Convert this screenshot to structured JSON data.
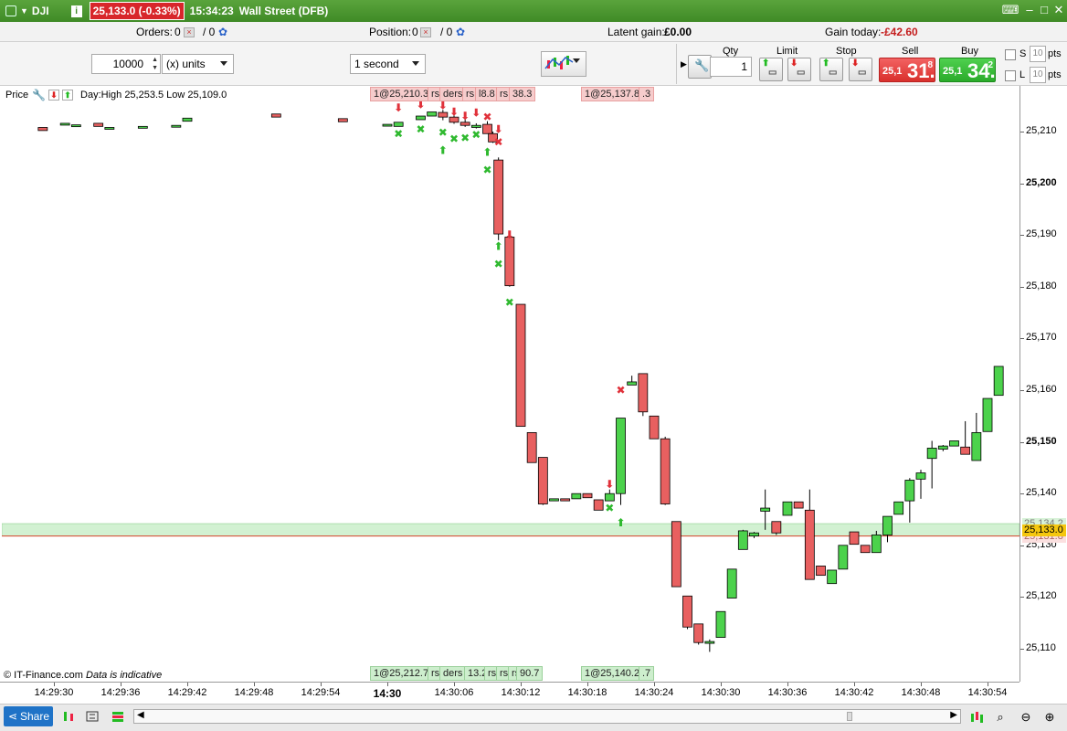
{
  "title_bar": {
    "symbol": "DJI",
    "price_badge": "25,133.0 (-0.33%)",
    "time": "15:34:23",
    "market": "Wall Street (DFB)"
  },
  "orders_row": {
    "orders_label": "Orders:",
    "orders_value": "0",
    "orders_slash": "/ 0",
    "position_label": "Position:",
    "position_value": "0",
    "position_slash": "/ 0",
    "latent_label": "Latent gain:",
    "latent_value": "£0.00",
    "gain_label": "Gain today:",
    "gain_value": "-£42.60"
  },
  "toolbar": {
    "quantity_value": "10000",
    "units_select": "(x) units",
    "interval_select": "1 second",
    "qty_header": "Qty",
    "qty_value": "1",
    "limit_header": "Limit",
    "stop_header": "Stop",
    "sell_header": "Sell",
    "buy_header": "Buy",
    "sell_small": "25,1",
    "sell_big": "31.",
    "sell_sup": "8",
    "buy_small": "25,1",
    "buy_big": "34.",
    "buy_sup": "2",
    "s_label": "S",
    "l_label": "L",
    "s_pts": "10",
    "l_pts": "10",
    "pts_label": "pts"
  },
  "chart_legend": {
    "price_label": "Price",
    "day_range": "Day:High 25,253.5 Low 25,109.0"
  },
  "order_tags": {
    "top": [
      "1@25,210.3",
      "rs",
      "ders",
      "rs",
      "l8.8",
      "rs",
      "38.3",
      "1@25,137.8",
      ".3"
    ],
    "bottom": [
      "1@25,212.7",
      "rs",
      "ders",
      "13.2",
      "rs",
      "rs",
      "rs",
      "90.7",
      "1@25,140.2",
      ".7"
    ]
  },
  "price_markers": {
    "buy_tag": "25,134.2",
    "current": "25,133.0",
    "sell_tag": "25,131.8"
  },
  "copyright": {
    "text": "© IT-Finance.com",
    "note": "Data is indicative"
  },
  "bottom_bar": {
    "share_label": "Share"
  },
  "colors": {
    "bull": "#4cd24c",
    "bear": "#e86060",
    "brand": "#4a9a30"
  },
  "chart_data": {
    "type": "candlestick",
    "title": "",
    "xlabel": "",
    "ylabel": "",
    "ylim": [
      25105,
      25220
    ],
    "yticks": [
      25110,
      25120,
      25130,
      25140,
      25150,
      25160,
      25170,
      25180,
      25190,
      25200,
      25210
    ],
    "xticks": [
      "14:29:30",
      "14:29:36",
      "14:29:42",
      "14:29:48",
      "14:29:54",
      "14:30",
      "14:30:06",
      "14:30:12",
      "14:30:18",
      "14:30:24",
      "14:30:30",
      "14:30:36",
      "14:30:42",
      "14:30:48",
      "14:30:54"
    ],
    "candles": [
      {
        "t": "14:29:29",
        "o": 25210.8,
        "h": 25210.8,
        "l": 25210.2,
        "c": 25210.2
      },
      {
        "t": "14:29:31",
        "o": 25211.6,
        "h": 25211.6,
        "l": 25211.6,
        "c": 25211.6
      },
      {
        "t": "14:29:32",
        "o": 25211.3,
        "h": 25211.3,
        "l": 25211.3,
        "c": 25211.3
      },
      {
        "t": "14:29:34",
        "o": 25211.6,
        "h": 25211.6,
        "l": 25211.0,
        "c": 25211.0
      },
      {
        "t": "14:29:35",
        "o": 25210.8,
        "h": 25210.8,
        "l": 25210.8,
        "c": 25210.8
      },
      {
        "t": "14:29:38",
        "o": 25211.0,
        "h": 25211.0,
        "l": 25211.0,
        "c": 25211.0
      },
      {
        "t": "14:29:41",
        "o": 25211.2,
        "h": 25211.2,
        "l": 25211.2,
        "c": 25211.2
      },
      {
        "t": "14:29:42",
        "o": 25212.0,
        "h": 25212.6,
        "l": 25212.0,
        "c": 25212.6
      },
      {
        "t": "14:29:50",
        "o": 25213.4,
        "h": 25213.4,
        "l": 25212.8,
        "c": 25212.8
      },
      {
        "t": "14:29:56",
        "o": 25212.5,
        "h": 25212.5,
        "l": 25211.9,
        "c": 25211.9
      },
      {
        "t": "14:30:00",
        "o": 25211.4,
        "h": 25211.4,
        "l": 25211.4,
        "c": 25211.4
      },
      {
        "t": "14:30:01",
        "o": 25211.0,
        "h": 25211.8,
        "l": 25211.0,
        "c": 25211.8
      },
      {
        "t": "14:30:03",
        "o": 25212.3,
        "h": 25213.0,
        "l": 25212.3,
        "c": 25213.0
      },
      {
        "t": "14:30:04",
        "o": 25213.0,
        "h": 25213.8,
        "l": 25213.0,
        "c": 25213.8
      },
      {
        "t": "14:30:05",
        "o": 25213.7,
        "h": 25214.2,
        "l": 25212.2,
        "c": 25212.8
      },
      {
        "t": "14:30:06",
        "o": 25212.8,
        "h": 25213.2,
        "l": 25211.5,
        "c": 25211.8
      },
      {
        "t": "14:30:07",
        "o": 25211.8,
        "h": 25212.6,
        "l": 25210.9,
        "c": 25211.2
      },
      {
        "t": "14:30:08",
        "o": 25210.8,
        "h": 25211.6,
        "l": 25210.6,
        "c": 25211.2
      },
      {
        "t": "14:30:09",
        "o": 25211.4,
        "h": 25212.0,
        "l": 25209.6,
        "c": 25209.6
      },
      {
        "t": "14:30:09.5",
        "o": 25209.6,
        "h": 25210.0,
        "l": 25207.8,
        "c": 25208.0
      },
      {
        "t": "14:30:10",
        "o": 25204.5,
        "h": 25205.0,
        "l": 25189.0,
        "c": 25190.2
      },
      {
        "t": "14:30:11",
        "o": 25189.6,
        "h": 25190.0,
        "l": 25180.0,
        "c": 25180.2
      },
      {
        "t": "14:30:12",
        "o": 25176.6,
        "h": 25176.6,
        "l": 25153.0,
        "c": 25153.0
      },
      {
        "t": "14:30:13",
        "o": 25151.8,
        "h": 25151.8,
        "l": 25146.0,
        "c": 25146.0
      },
      {
        "t": "14:30:14",
        "o": 25147.0,
        "h": 25147.0,
        "l": 25137.8,
        "c": 25138.0
      },
      {
        "t": "14:30:15",
        "o": 25138.6,
        "h": 25139.0,
        "l": 25138.6,
        "c": 25139.0
      },
      {
        "t": "14:30:16",
        "o": 25139.0,
        "h": 25139.0,
        "l": 25138.6,
        "c": 25138.6
      },
      {
        "t": "14:30:17",
        "o": 25139.0,
        "h": 25140.0,
        "l": 25139.0,
        "c": 25140.0
      },
      {
        "t": "14:30:18",
        "o": 25140.0,
        "h": 25140.0,
        "l": 25139.2,
        "c": 25139.2
      },
      {
        "t": "14:30:19",
        "o": 25138.8,
        "h": 25138.8,
        "l": 25136.8,
        "c": 25136.8
      },
      {
        "t": "14:30:20",
        "o": 25138.6,
        "h": 25140.8,
        "l": 25138.6,
        "c": 25140.0
      },
      {
        "t": "14:30:21",
        "o": 25140.0,
        "h": 25154.6,
        "l": 25137.8,
        "c": 25154.6
      },
      {
        "t": "14:30:22",
        "o": 25161.0,
        "h": 25162.8,
        "l": 25161.0,
        "c": 25161.6
      },
      {
        "t": "14:30:23",
        "o": 25163.2,
        "h": 25163.2,
        "l": 25155.0,
        "c": 25155.8
      },
      {
        "t": "14:30:24",
        "o": 25155.0,
        "h": 25155.0,
        "l": 25150.6,
        "c": 25150.6
      },
      {
        "t": "14:30:25",
        "o": 25150.6,
        "h": 25151.0,
        "l": 25137.8,
        "c": 25138.0
      },
      {
        "t": "14:30:26",
        "o": 25134.6,
        "h": 25134.6,
        "l": 25122.0,
        "c": 25122.0
      },
      {
        "t": "14:30:27",
        "o": 25120.2,
        "h": 25120.2,
        "l": 25113.8,
        "c": 25114.2
      },
      {
        "t": "14:30:28",
        "o": 25114.8,
        "h": 25114.8,
        "l": 25110.8,
        "c": 25111.2
      },
      {
        "t": "14:30:29",
        "o": 25111.2,
        "h": 25111.8,
        "l": 25109.4,
        "c": 25111.4
      },
      {
        "t": "14:30:30",
        "o": 25112.2,
        "h": 25117.2,
        "l": 25112.2,
        "c": 25117.2
      },
      {
        "t": "14:30:31",
        "o": 25119.8,
        "h": 25125.4,
        "l": 25119.8,
        "c": 25125.4
      },
      {
        "t": "14:30:32",
        "o": 25129.2,
        "h": 25133.0,
        "l": 25129.2,
        "c": 25132.8
      },
      {
        "t": "14:30:33",
        "o": 25131.8,
        "h": 25132.6,
        "l": 25131.4,
        "c": 25132.4
      },
      {
        "t": "14:30:34",
        "o": 25136.6,
        "h": 25140.8,
        "l": 25133.0,
        "c": 25137.2
      },
      {
        "t": "14:30:35",
        "o": 25134.6,
        "h": 25134.6,
        "l": 25132.0,
        "c": 25132.4
      },
      {
        "t": "14:30:36",
        "o": 25135.8,
        "h": 25138.4,
        "l": 25135.8,
        "c": 25138.4
      },
      {
        "t": "14:30:37",
        "o": 25138.4,
        "h": 25138.4,
        "l": 25137.2,
        "c": 25137.2
      },
      {
        "t": "14:30:38",
        "o": 25136.8,
        "h": 25140.8,
        "l": 25123.4,
        "c": 25123.4
      },
      {
        "t": "14:30:39",
        "o": 25126.0,
        "h": 25126.0,
        "l": 25124.2,
        "c": 25124.2
      },
      {
        "t": "14:30:40",
        "o": 25122.6,
        "h": 25125.2,
        "l": 25122.6,
        "c": 25125.2
      },
      {
        "t": "14:30:41",
        "o": 25125.4,
        "h": 25130.0,
        "l": 25125.4,
        "c": 25130.0
      },
      {
        "t": "14:30:42",
        "o": 25132.6,
        "h": 25132.6,
        "l": 25130.2,
        "c": 25130.2
      },
      {
        "t": "14:30:43",
        "o": 25130.0,
        "h": 25130.0,
        "l": 25128.6,
        "c": 25128.6
      },
      {
        "t": "14:30:44",
        "o": 25128.6,
        "h": 25132.8,
        "l": 25128.6,
        "c": 25132.0
      },
      {
        "t": "14:30:45",
        "o": 25132.0,
        "h": 25135.6,
        "l": 25130.6,
        "c": 25135.6
      },
      {
        "t": "14:30:46",
        "o": 25136.0,
        "h": 25138.4,
        "l": 25136.0,
        "c": 25138.4
      },
      {
        "t": "14:30:47",
        "o": 25138.6,
        "h": 25143.0,
        "l": 25134.4,
        "c": 25142.6
      },
      {
        "t": "14:30:48",
        "o": 25142.8,
        "h": 25144.6,
        "l": 25139.0,
        "c": 25144.0
      },
      {
        "t": "14:30:49",
        "o": 25146.8,
        "h": 25150.2,
        "l": 25141.0,
        "c": 25148.8
      },
      {
        "t": "14:30:50",
        "o": 25148.6,
        "h": 25149.4,
        "l": 25148.2,
        "c": 25149.2
      },
      {
        "t": "14:30:51",
        "o": 25149.2,
        "h": 25150.2,
        "l": 25149.2,
        "c": 25150.2
      },
      {
        "t": "14:30:52",
        "o": 25149.0,
        "h": 25154.0,
        "l": 25147.6,
        "c": 25147.6
      },
      {
        "t": "14:30:53",
        "o": 25146.4,
        "h": 25155.6,
        "l": 25146.4,
        "c": 25151.8
      },
      {
        "t": "14:30:54",
        "o": 25152.0,
        "h": 25158.4,
        "l": 25152.0,
        "c": 25158.4
      },
      {
        "t": "14:30:55",
        "o": 25159.0,
        "h": 25164.6,
        "l": 25159.0,
        "c": 25164.6
      }
    ]
  }
}
